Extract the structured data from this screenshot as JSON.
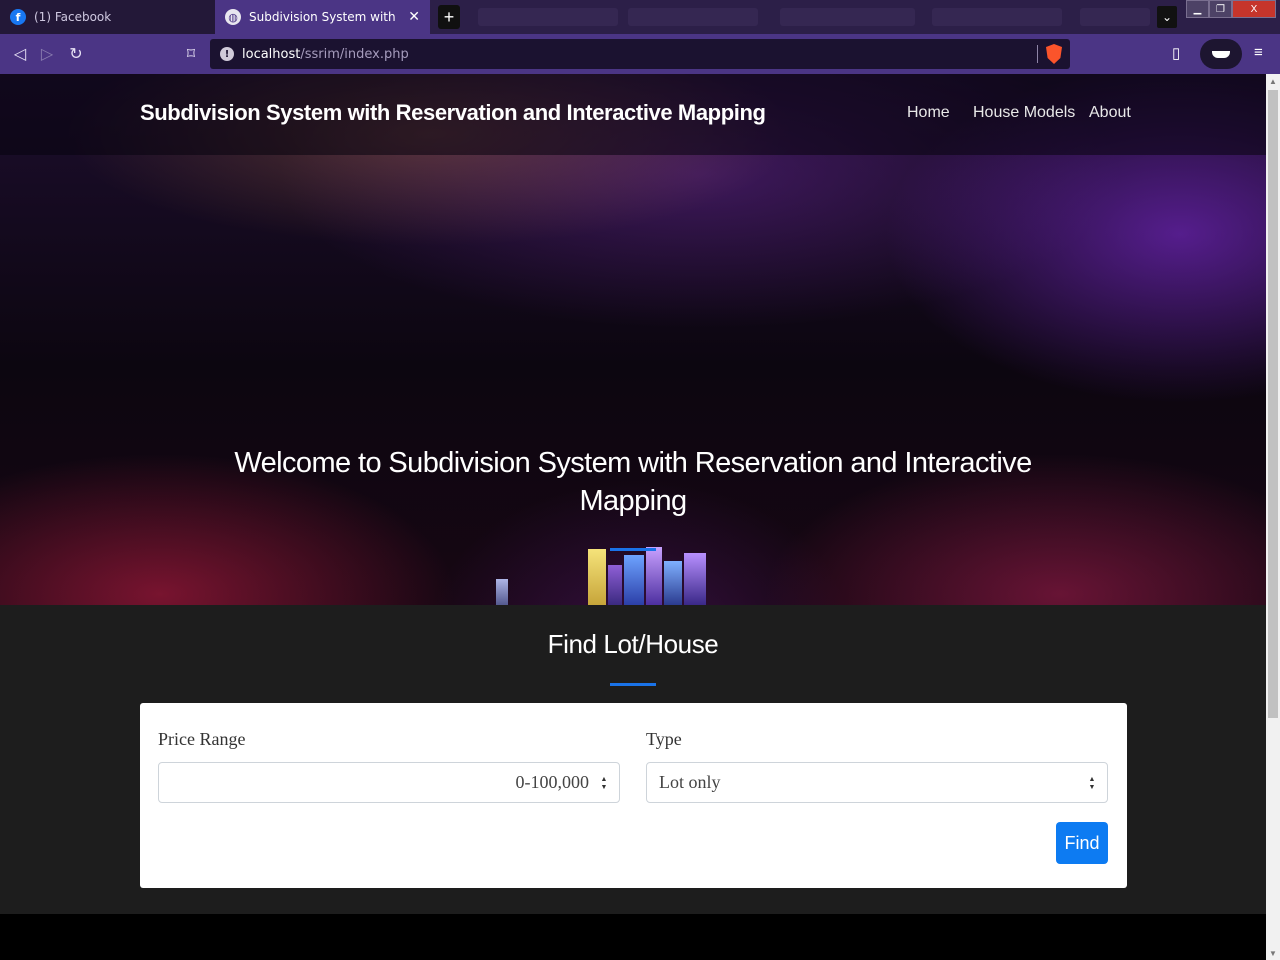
{
  "browser": {
    "tabs": [
      {
        "title": "(1) Facebook",
        "favicon": "facebook-icon"
      },
      {
        "title": "Subdivision System with Reservati",
        "favicon": "globe-icon"
      }
    ],
    "new_tab": "+",
    "close_glyph": "✕",
    "tab_list_glyph": "⌄",
    "window_controls": {
      "minimize": "▁",
      "maximize": "❐",
      "close": "X"
    },
    "url_host": "localhost",
    "url_path": "/ssrim/index.php"
  },
  "site": {
    "brand": "Subdivision System with Reservation and Interactive Mapping",
    "nav": [
      "Home",
      "House Models",
      "About"
    ],
    "hero_title": "Welcome to Subdivision System with Reservation and Interactive Mapping"
  },
  "find": {
    "title": "Find Lot/House",
    "price_label": "Price Range",
    "price_value": "0-100,000",
    "type_label": "Type",
    "type_value": "Lot only",
    "button": "Find"
  },
  "colors": {
    "browser_toolbar": "#4b3585",
    "tab_strip": "#2c1f48",
    "accent_blue": "#0d7bf2",
    "section_bg": "#1d1d1d"
  }
}
